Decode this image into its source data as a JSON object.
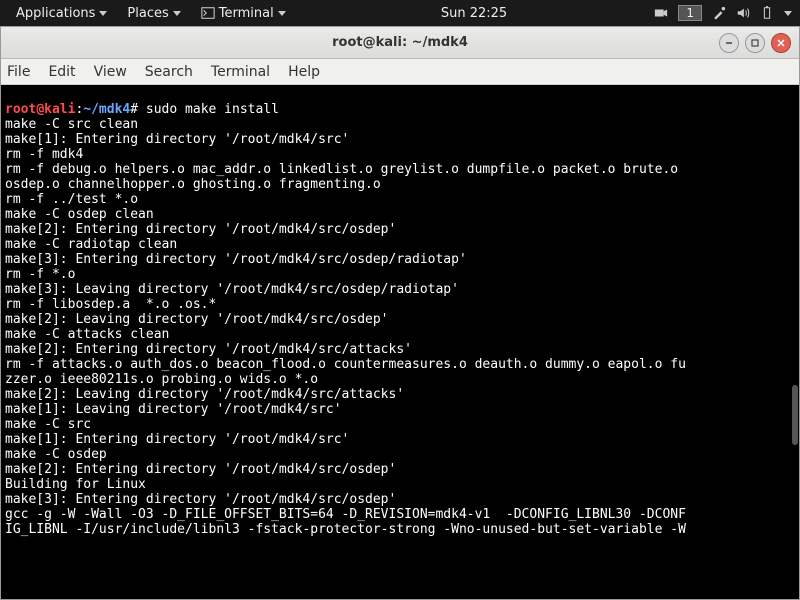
{
  "topbar": {
    "applications": "Applications",
    "places": "Places",
    "terminal": "Terminal",
    "clock": "Sun 22:25",
    "workspace": "1"
  },
  "window": {
    "title": "root@kali: ~/mdk4"
  },
  "menubar": {
    "file": "File",
    "edit": "Edit",
    "view": "View",
    "search": "Search",
    "terminal": "Terminal",
    "help": "Help"
  },
  "prompt": {
    "user": "root",
    "at": "@",
    "host": "kali",
    "colon": ":",
    "path": "~/mdk4",
    "hash": "#",
    "command": " sudo make install"
  },
  "output": [
    "make -C src clean",
    "make[1]: Entering directory '/root/mdk4/src'",
    "rm -f mdk4",
    "rm -f debug.o helpers.o mac_addr.o linkedlist.o greylist.o dumpfile.o packet.o brute.o ",
    "osdep.o channelhopper.o ghosting.o fragmenting.o",
    "rm -f ../test *.o",
    "make -C osdep clean",
    "make[2]: Entering directory '/root/mdk4/src/osdep'",
    "make -C radiotap clean",
    "make[3]: Entering directory '/root/mdk4/src/osdep/radiotap'",
    "rm -f *.o",
    "make[3]: Leaving directory '/root/mdk4/src/osdep/radiotap'",
    "rm -f libosdep.a  *.o .os.*",
    "make[2]: Leaving directory '/root/mdk4/src/osdep'",
    "make -C attacks clean",
    "make[2]: Entering directory '/root/mdk4/src/attacks'",
    "rm -f attacks.o auth_dos.o beacon_flood.o countermeasures.o deauth.o dummy.o eapol.o fu",
    "zzer.o ieee80211s.o probing.o wids.o *.o",
    "make[2]: Leaving directory '/root/mdk4/src/attacks'",
    "make[1]: Leaving directory '/root/mdk4/src'",
    "make -C src",
    "make[1]: Entering directory '/root/mdk4/src'",
    "make -C osdep",
    "make[2]: Entering directory '/root/mdk4/src/osdep'",
    "Building for Linux",
    "make[3]: Entering directory '/root/mdk4/src/osdep'",
    "gcc -g -W -Wall -O3 -D_FILE_OFFSET_BITS=64 -D_REVISION=mdk4-v1  -DCONFIG_LIBNL30 -DCONF",
    "IG_LIBNL -I/usr/include/libnl3 -fstack-protector-strong -Wno-unused-but-set-variable -W"
  ]
}
